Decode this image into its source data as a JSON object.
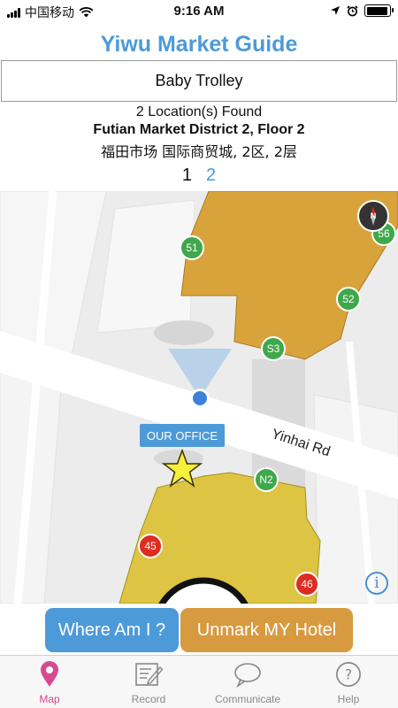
{
  "status_bar": {
    "carrier": "中国移动",
    "time": "9:16 AM"
  },
  "app_title": "Yiwu Market Guide",
  "search": {
    "value": "Baby Trolley"
  },
  "results": {
    "found_text": "2 Location(s) Found",
    "district": "Futian Market District  2, Floor 2",
    "district_chinese": "福田市场 国际商贸城, 2区, 2层"
  },
  "pager": {
    "page_1": "1",
    "page_2": "2"
  },
  "map": {
    "road_label": "Yinhai Rd",
    "office_label": "OUR OFFICE",
    "compass_label": "N",
    "info_label": "i",
    "markers": {
      "m51": "51",
      "m56": "56",
      "m52": "52",
      "mS3": "S3",
      "mN2": "N2",
      "m45": "45",
      "m46": "46"
    },
    "colors": {
      "green_marker": "#3ea84a",
      "red_marker": "#e02b20",
      "orange_building": "#d9a33c",
      "yellow_building": "#ddc443"
    }
  },
  "buttons": {
    "where_am_i": "Where Am I ?",
    "unmark_hotel": "Unmark MY Hotel"
  },
  "tabs": {
    "map": "Map",
    "record": "Record",
    "communicate": "Communicate",
    "help": "Help"
  },
  "colors": {
    "accent_blue": "#4d9ad8",
    "hotel_button": "#d79a3f",
    "active_tab": "#d64b8f"
  }
}
